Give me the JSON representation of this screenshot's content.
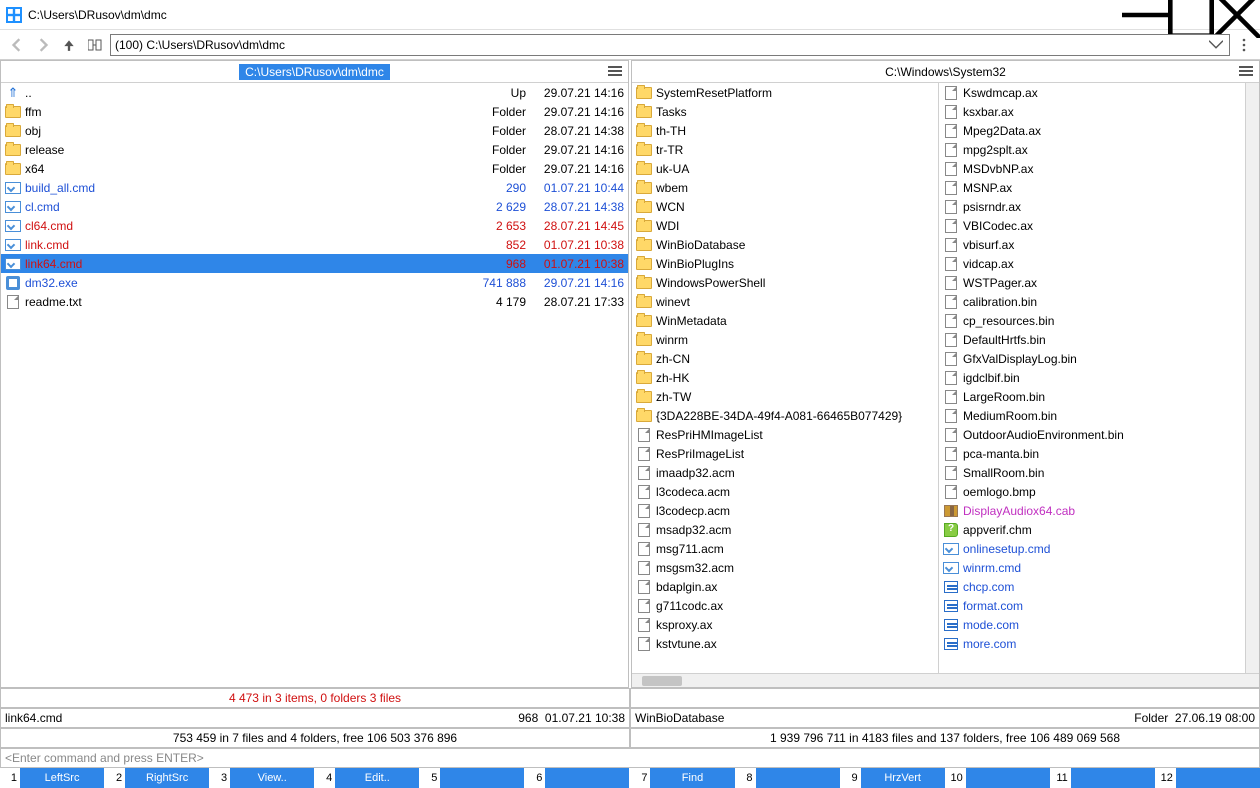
{
  "window": {
    "title": "C:\\Users\\DRusov\\dm\\dmc"
  },
  "address": "(100) C:\\Users\\DRusov\\dm\\dmc",
  "left": {
    "path": "C:\\Users\\DRusov\\dm\\dmc",
    "rows": [
      {
        "icon": "up",
        "name": "..",
        "size": "Up",
        "date": "29.07.21 14:16",
        "cls": "c-black"
      },
      {
        "icon": "folder",
        "name": "ffm",
        "size": "Folder",
        "date": "29.07.21 14:16",
        "cls": "c-black"
      },
      {
        "icon": "folder",
        "name": "obj",
        "size": "Folder",
        "date": "28.07.21 14:38",
        "cls": "c-black"
      },
      {
        "icon": "folder",
        "name": "release",
        "size": "Folder",
        "date": "29.07.21 14:16",
        "cls": "c-black"
      },
      {
        "icon": "folder",
        "name": "x64",
        "size": "Folder",
        "date": "29.07.21 14:16",
        "cls": "c-black"
      },
      {
        "icon": "cmd",
        "name": "build_all.cmd",
        "size": "290",
        "date": "01.07.21 10:44",
        "cls": "c-blue"
      },
      {
        "icon": "cmd",
        "name": "cl.cmd",
        "size": "2 629",
        "date": "28.07.21 14:38",
        "cls": "c-blue"
      },
      {
        "icon": "cmd",
        "name": "cl64.cmd",
        "size": "2 653",
        "date": "28.07.21 14:45",
        "cls": "c-red"
      },
      {
        "icon": "cmd",
        "name": "link.cmd",
        "size": "852",
        "date": "01.07.21 10:38",
        "cls": "c-red"
      },
      {
        "icon": "cmd",
        "name": "link64.cmd",
        "size": "968",
        "date": "01.07.21 10:38",
        "cls": "c-red",
        "sel": true
      },
      {
        "icon": "exe",
        "name": "dm32.exe",
        "size": "741 888",
        "date": "29.07.21 14:16",
        "cls": "c-blue"
      },
      {
        "icon": "file",
        "name": "readme.txt",
        "size": "4 179",
        "date": "28.07.21 17:33",
        "cls": "c-black"
      }
    ],
    "sel_summary": "4 473 in 3 items, 0 folders 3 files",
    "cur": {
      "name": "link64.cmd",
      "size": "968",
      "date": "01.07.21 10:38"
    },
    "free": "753 459 in 7 files and 4 folders, free 106 503 376 896"
  },
  "right": {
    "path": "C:\\Windows\\System32",
    "col1": [
      {
        "icon": "folder",
        "name": "SystemResetPlatform"
      },
      {
        "icon": "folder",
        "name": "Tasks"
      },
      {
        "icon": "folder",
        "name": "th-TH"
      },
      {
        "icon": "folder",
        "name": "tr-TR"
      },
      {
        "icon": "folder",
        "name": "uk-UA"
      },
      {
        "icon": "folder",
        "name": "wbem"
      },
      {
        "icon": "folder",
        "name": "WCN"
      },
      {
        "icon": "folder",
        "name": "WDI"
      },
      {
        "icon": "folder",
        "name": "WinBioDatabase"
      },
      {
        "icon": "folder",
        "name": "WinBioPlugIns"
      },
      {
        "icon": "folder",
        "name": "WindowsPowerShell"
      },
      {
        "icon": "folder",
        "name": "winevt"
      },
      {
        "icon": "folder",
        "name": "WinMetadata"
      },
      {
        "icon": "folder",
        "name": "winrm"
      },
      {
        "icon": "folder",
        "name": "zh-CN"
      },
      {
        "icon": "folder",
        "name": "zh-HK"
      },
      {
        "icon": "folder",
        "name": "zh-TW"
      },
      {
        "icon": "folder",
        "name": "{3DA228BE-34DA-49f4-A081-66465B077429}"
      },
      {
        "icon": "file",
        "name": "ResPriHMImageList"
      },
      {
        "icon": "file",
        "name": "ResPriImageList"
      },
      {
        "icon": "file",
        "name": "imaadp32.acm"
      },
      {
        "icon": "file",
        "name": "l3codeca.acm"
      },
      {
        "icon": "file",
        "name": "l3codecp.acm"
      },
      {
        "icon": "file",
        "name": "msadp32.acm"
      },
      {
        "icon": "file",
        "name": "msg711.acm"
      },
      {
        "icon": "file",
        "name": "msgsm32.acm"
      },
      {
        "icon": "file",
        "name": "bdaplgin.ax"
      },
      {
        "icon": "file",
        "name": "g711codc.ax"
      },
      {
        "icon": "file",
        "name": "ksproxy.ax"
      },
      {
        "icon": "file",
        "name": "kstvtune.ax"
      }
    ],
    "col2": [
      {
        "icon": "file",
        "name": "Kswdmcap.ax"
      },
      {
        "icon": "file",
        "name": "ksxbar.ax"
      },
      {
        "icon": "file",
        "name": "Mpeg2Data.ax"
      },
      {
        "icon": "file",
        "name": "mpg2splt.ax"
      },
      {
        "icon": "file",
        "name": "MSDvbNP.ax"
      },
      {
        "icon": "file",
        "name": "MSNP.ax"
      },
      {
        "icon": "file",
        "name": "psisrndr.ax"
      },
      {
        "icon": "file",
        "name": "VBICodec.ax"
      },
      {
        "icon": "file",
        "name": "vbisurf.ax"
      },
      {
        "icon": "file",
        "name": "vidcap.ax"
      },
      {
        "icon": "file",
        "name": "WSTPager.ax"
      },
      {
        "icon": "file",
        "name": "calibration.bin"
      },
      {
        "icon": "file",
        "name": "cp_resources.bin"
      },
      {
        "icon": "file",
        "name": "DefaultHrtfs.bin"
      },
      {
        "icon": "file",
        "name": "GfxValDisplayLog.bin"
      },
      {
        "icon": "file",
        "name": "igdclbif.bin"
      },
      {
        "icon": "file",
        "name": "LargeRoom.bin"
      },
      {
        "icon": "file",
        "name": "MediumRoom.bin"
      },
      {
        "icon": "file",
        "name": "OutdoorAudioEnvironment.bin"
      },
      {
        "icon": "file",
        "name": "pca-manta.bin"
      },
      {
        "icon": "file",
        "name": "SmallRoom.bin"
      },
      {
        "icon": "file",
        "name": "oemlogo.bmp"
      },
      {
        "icon": "cab",
        "name": "DisplayAudiox64.cab",
        "cls": "c-mag"
      },
      {
        "icon": "chm",
        "name": "appverif.chm"
      },
      {
        "icon": "cmd",
        "name": "onlinesetup.cmd",
        "cls": "c-blue"
      },
      {
        "icon": "cmd",
        "name": "winrm.cmd",
        "cls": "c-blue"
      },
      {
        "icon": "com",
        "name": "chcp.com",
        "cls": "c-blue"
      },
      {
        "icon": "com",
        "name": "format.com",
        "cls": "c-blue"
      },
      {
        "icon": "com",
        "name": "mode.com",
        "cls": "c-blue"
      },
      {
        "icon": "com",
        "name": "more.com",
        "cls": "c-blue"
      }
    ],
    "cur": {
      "name": "WinBioDatabase",
      "size": "Folder",
      "date": "27.06.19 08:00"
    },
    "free": "1 939 796 711 in 4183 files and 137 folders, free 106 489 069 568"
  },
  "cmd_placeholder": "<Enter command and press ENTER>",
  "fkeys": [
    {
      "n": "1",
      "l": "LeftSrc"
    },
    {
      "n": "2",
      "l": "RightSrc"
    },
    {
      "n": "3",
      "l": "View.."
    },
    {
      "n": "4",
      "l": "Edit.."
    },
    {
      "n": "5",
      "l": ""
    },
    {
      "n": "6",
      "l": ""
    },
    {
      "n": "7",
      "l": "Find"
    },
    {
      "n": "8",
      "l": ""
    },
    {
      "n": "9",
      "l": "HrzVert"
    },
    {
      "n": "10",
      "l": ""
    },
    {
      "n": "11",
      "l": ""
    },
    {
      "n": "12",
      "l": ""
    }
  ]
}
